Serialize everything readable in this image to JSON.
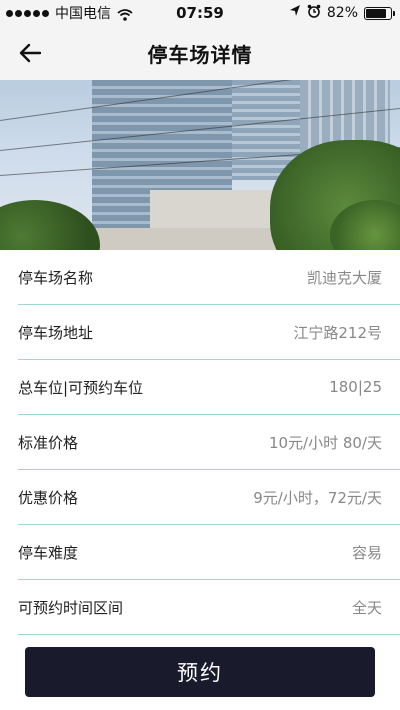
{
  "status_bar": {
    "carrier": "中国电信",
    "time": "07:59",
    "battery": "82%",
    "battery_level": 0.82,
    "icons": [
      "signal-dots-icon",
      "wifi-icon",
      "location-arrow-icon",
      "alarm-clock-icon",
      "battery-icon"
    ]
  },
  "nav": {
    "title": "停车场详情",
    "back_icon": "back-arrow-icon"
  },
  "hero": {
    "image": "parking-building-photo"
  },
  "details": [
    {
      "label": "停车场名称",
      "value": "凯迪克大厦"
    },
    {
      "label": "停车场地址",
      "value": "江宁路212号"
    },
    {
      "label": "总车位|可预约车位",
      "value": "180|25"
    },
    {
      "label": "标准价格",
      "value": "10元/小时 80/天"
    },
    {
      "label": "优惠价格",
      "value": "9元/小时，72元/天"
    },
    {
      "label": "停车难度",
      "value": "容易"
    },
    {
      "label": "可预约时间区间",
      "value": "全天"
    }
  ],
  "actions": {
    "reserve_label": "预约"
  },
  "colors": {
    "divider": "#9fd6cf",
    "button_bg": "#191a2c",
    "value_text": "#888888",
    "bar_bg": "#f4f4f4"
  }
}
